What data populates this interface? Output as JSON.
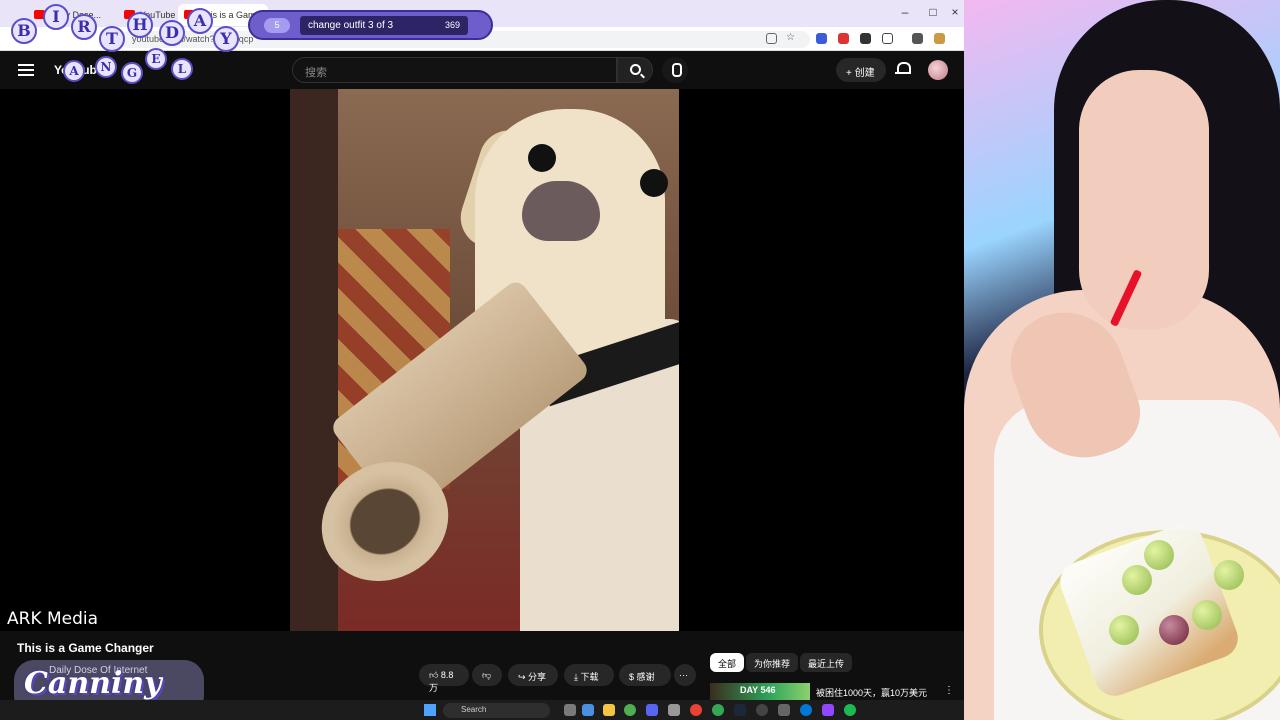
{
  "browser": {
    "tabs": [
      "Daily Dose...",
      "YouTube",
      "This is a Game Changer"
    ],
    "window_controls": [
      "–",
      "□",
      "×"
    ],
    "url": "youtube.com/watch?v=...ejqcp"
  },
  "youtube": {
    "logo": "YouTube",
    "search_placeholder": "搜索",
    "create_label": "+ 创建",
    "video": {
      "watermark": "ARK Media",
      "title": "This is a Game Changer",
      "channel": "Daily Dose Of Internet"
    },
    "actions": {
      "like_count": "8.8万",
      "share": "分享",
      "download": "下载",
      "thanks": "感谢",
      "more": "···"
    },
    "chips": [
      "全部",
      "为你推荐",
      "最近上传"
    ],
    "recommendation": {
      "thumb_text": "DAY 546",
      "title": "被困住1000天，赢10万美元"
    }
  },
  "overlays": {
    "birthday_letters_top": [
      "B",
      "I",
      "R",
      "T",
      "H",
      "D",
      "A",
      "Y"
    ],
    "birthday_letters_bottom": [
      "A",
      "N",
      "G",
      "E",
      "L"
    ],
    "outfit": {
      "index": "5",
      "label": "change outfit 3 of 3",
      "count": "369"
    },
    "streamer_name": "Canniny"
  },
  "taskbar": {
    "search_label": "Search"
  },
  "colors": {
    "accent_purple": "#6d5ecb",
    "youtube_red": "#ff0000",
    "background": "#0f0f0f"
  }
}
